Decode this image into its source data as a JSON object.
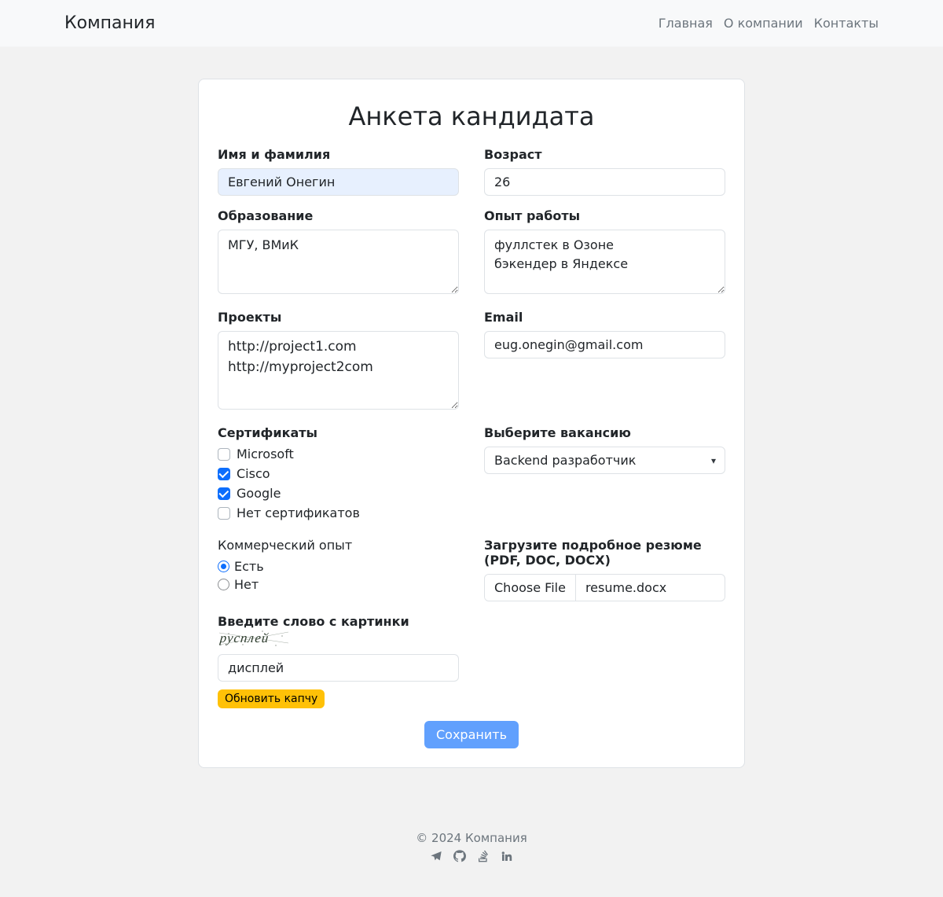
{
  "brand": "Компания",
  "nav": {
    "home": "Главная",
    "about": "О компании",
    "contacts": "Контакты"
  },
  "form": {
    "title": "Анкета кандидата",
    "name": {
      "label": "Имя и фамилия",
      "value": "Евгений Онегин"
    },
    "age": {
      "label": "Возраст",
      "value": "26"
    },
    "education": {
      "label": "Образование",
      "value": "МГУ, ВМиК"
    },
    "exp": {
      "label": "Опыт работы",
      "value": "фуллстек в Озоне\nбэкендер в Яндексе"
    },
    "projects": {
      "label": "Проекты",
      "value": "http://project1.com\nhttp://myproject2com"
    },
    "email": {
      "label": "Email",
      "value": "eug.onegin@gmail.com"
    },
    "certs": {
      "label": "Сертификаты",
      "options": {
        "microsoft": "Microsoft",
        "cisco": "Cisco",
        "google": "Google",
        "none": "Нет сертификатов"
      },
      "checked": {
        "microsoft": false,
        "cisco": true,
        "google": true,
        "none": false
      }
    },
    "vacancy": {
      "label": "Выберите вакансию",
      "selected": "Backend разработчик"
    },
    "commercial": {
      "label": "Коммерческий опыт",
      "yes": "Есть",
      "no": "Нет",
      "value": "yes"
    },
    "resume": {
      "label": "Загрузите подробное резюме (PDF, DOC, DOCX)",
      "button": "Choose File",
      "filename": "resume.docx"
    },
    "captcha": {
      "label": "Введите слово с картинки",
      "image_text": "русплей",
      "value": "дисплей",
      "refresh": "Обновить капчу"
    },
    "submit": "Сохранить"
  },
  "footer": {
    "copyright": "© 2024 Компания"
  }
}
